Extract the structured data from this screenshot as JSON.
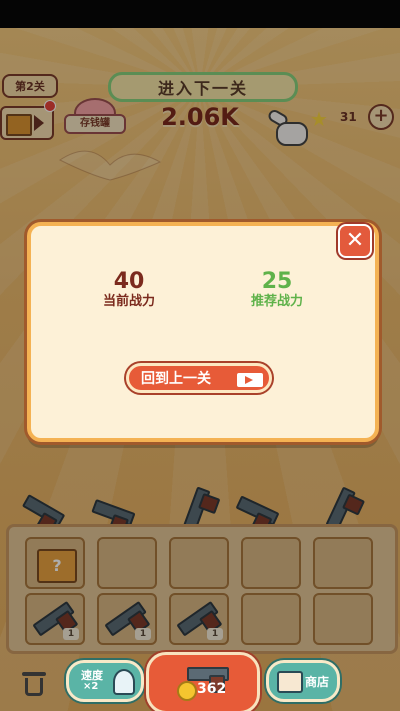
{
  "header": {
    "level_label": "第2关",
    "next_level_button": "进入下一关",
    "piggy_bank_label": "存钱罐",
    "money": "2.06K",
    "star_count": "31",
    "plus_label": "+"
  },
  "dialog": {
    "close_label": "✕",
    "current_power": {
      "value": "40",
      "label": "当前战力",
      "color": "#7b2a1d"
    },
    "recommended_power": {
      "value": "25",
      "label": "推荐战力",
      "color": "#5fb24a"
    },
    "return_button_label": "回到上一关"
  },
  "merge_grid": {
    "cells": [
      {
        "content": "mystery-box",
        "text": "?"
      },
      {
        "content": "empty"
      },
      {
        "content": "empty"
      },
      {
        "content": "empty"
      },
      {
        "content": "empty"
      },
      {
        "content": "pistol",
        "level": "1"
      },
      {
        "content": "pistol",
        "level": "1"
      },
      {
        "content": "pistol",
        "level": "1"
      },
      {
        "content": "empty"
      },
      {
        "content": "empty"
      }
    ]
  },
  "bottom_bar": {
    "speed_label": "速度",
    "speed_multiplier": "×2",
    "buy_price": "362",
    "shop_label": "商店"
  },
  "colors": {
    "background": "#e9b86c",
    "dialog_bg": "#fdf1d7",
    "button_red": "#e75b38",
    "button_teal": "#5ab4a6"
  }
}
